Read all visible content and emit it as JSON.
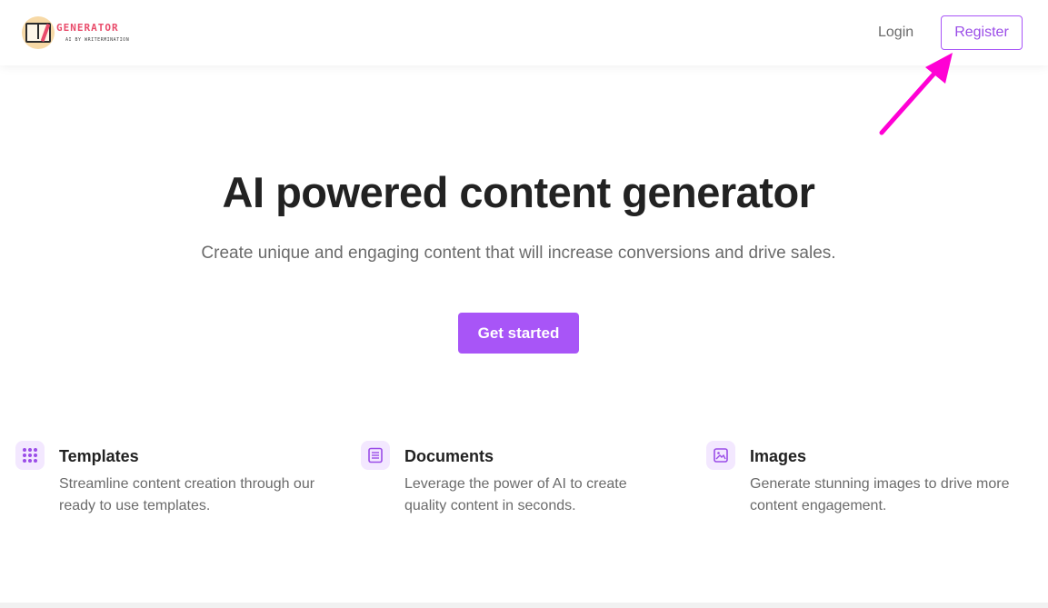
{
  "logo": {
    "title": "GENERATOR",
    "subtitle": "AI BY WRITERMINATION"
  },
  "nav": {
    "login_label": "Login",
    "register_label": "Register"
  },
  "hero": {
    "title": "AI powered content generator",
    "subtitle": "Create unique and engaging content that will increase conversions and drive sales.",
    "cta_label": "Get started"
  },
  "features": [
    {
      "icon": "grid-icon",
      "title": "Templates",
      "description": "Streamline content creation through our ready to use templates."
    },
    {
      "icon": "document-icon",
      "title": "Documents",
      "description": "Leverage the power of AI to create quality content in seconds."
    },
    {
      "icon": "image-icon",
      "title": "Images",
      "description": "Generate stunning images to drive more content engagement."
    }
  ],
  "colors": {
    "accent": "#a855f7",
    "annotation_arrow": "#ff00d4",
    "icon_bg": "#f3e8ff"
  }
}
